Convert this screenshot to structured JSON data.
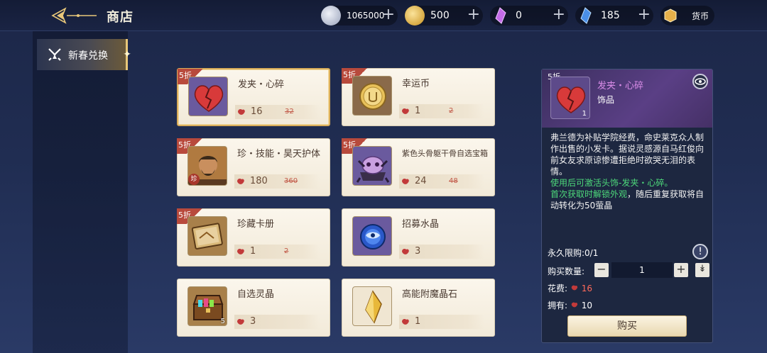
{
  "header": {
    "title": "商店"
  },
  "currencies": [
    {
      "icon": "silver-coin-icon",
      "value": "1065000",
      "color": "#c9cfe0"
    },
    {
      "icon": "gold-coin-icon",
      "value": "500",
      "color": "#e6b83a"
    },
    {
      "icon": "purple-crystal-icon",
      "value": "0",
      "color": "#b85ae0"
    },
    {
      "icon": "blue-crystal-icon",
      "value": "185",
      "color": "#4a8fe8"
    }
  ],
  "currency_menu_label": "货币",
  "sidebar": {
    "tab_label": "新春兑换"
  },
  "items": [
    {
      "discount": "5折",
      "name": "发夹・心碎",
      "price": "16",
      "original": "32"
    },
    {
      "discount": "5折",
      "name": "幸运币",
      "price": "1",
      "original": "2"
    },
    {
      "discount": "5折",
      "name": "珍・技能・昊天护体",
      "price": "180",
      "original": "360",
      "tag": "珍"
    },
    {
      "discount": "5折",
      "name": "紫色头骨躯干骨自选宝箱",
      "price": "24",
      "original": "48"
    },
    {
      "discount": "5折",
      "name": "珍藏卡册",
      "price": "1",
      "original": "2"
    },
    {
      "discount": "",
      "name": "招募水晶",
      "price": "3",
      "original": ""
    },
    {
      "discount": "",
      "name": "自选灵晶",
      "price": "3",
      "original": "",
      "count": "5"
    },
    {
      "discount": "",
      "name": "高能附魔晶石",
      "price": "1",
      "original": ""
    }
  ],
  "detail": {
    "discount": "5折",
    "name": "发夹・心碎",
    "type": "饰品",
    "count": "1",
    "desc_white": "弗兰德为补贴学院经费，命史莱克众人制作出售的小发卡。据说灵感源自马红俊向前女友求原谅惨遭拒绝时欲哭无泪的表情。",
    "desc_green": "使用后可激活头饰-发夹・心碎。",
    "desc_green2": "首次获取时解锁外观",
    "desc_white2": "，随后重复获取将自动转化为50萤晶",
    "limit_label": "永久限购:",
    "limit_value": "0/1",
    "qty_label": "购买数量:",
    "qty_value": "1",
    "cost_label": "花费:",
    "cost_value": "16",
    "own_label": "拥有:",
    "own_value": "10",
    "buy_label": "购买"
  },
  "colors": {
    "accent_gold": "#e8c77a",
    "discount_red": "#b84a3c",
    "price_red": "#c25b4a",
    "highlight_green": "#4dd87a"
  }
}
